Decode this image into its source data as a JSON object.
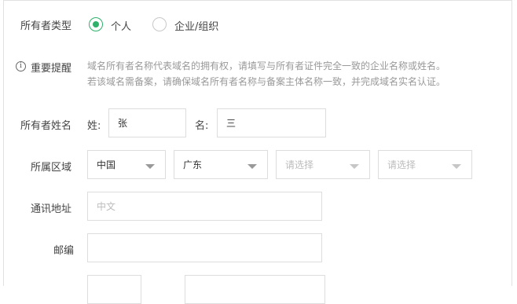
{
  "owner_type": {
    "label": "所有者类型",
    "options": [
      {
        "label": "个人",
        "checked": true
      },
      {
        "label": "企业/组织",
        "checked": false
      }
    ]
  },
  "notice": {
    "icon": "info-icon",
    "title": "重要提醒",
    "line1": "域名所有者名称代表域名的拥有权，请填写与所有者证件完全一致的企业名称或姓名。",
    "line2": "若该域名需备案，请确保域名所有者名称与备案主体名称一致，并完成域名实名认证。"
  },
  "owner_name": {
    "label": "所有者姓名",
    "surname_label": "姓:",
    "surname_value": "张",
    "given_label": "名:",
    "given_value": "三"
  },
  "region": {
    "label": "所属区域",
    "country": "中国",
    "province": "广东",
    "city_placeholder": "请选择",
    "district_placeholder": "请选择"
  },
  "address": {
    "label": "通讯地址",
    "placeholder": "中文"
  },
  "postcode": {
    "label": "邮编",
    "value": ""
  },
  "colors": {
    "accent": "#2fb06b",
    "border": "#dddddd",
    "placeholder": "#bcbcbc"
  }
}
